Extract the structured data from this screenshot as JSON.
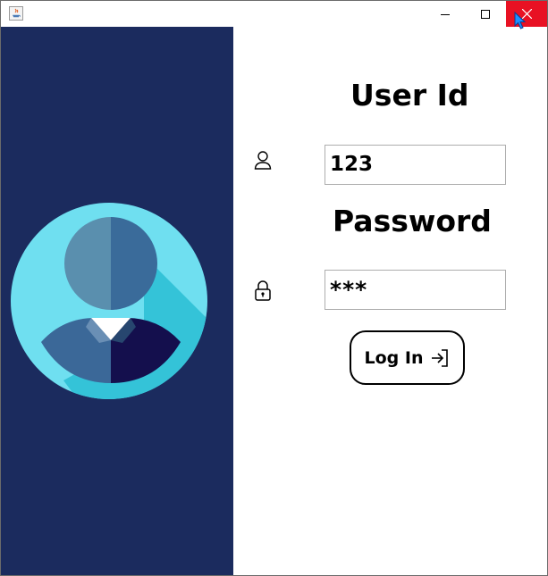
{
  "window": {
    "controls": {
      "minimize_icon": "minimize-icon",
      "maximize_icon": "maximize-icon",
      "close_icon": "close-icon"
    },
    "close_color": "#e81123"
  },
  "sidebar": {
    "background": "#1b2b5e",
    "avatar_icon": "user-avatar"
  },
  "form": {
    "user_id_label": "User Id",
    "user_id_value": "123",
    "user_icon": "user-icon",
    "password_label": "Password",
    "password_value": "***",
    "lock_icon": "lock-icon",
    "login_label": "Log In",
    "login_icon": "sign-in-icon"
  }
}
